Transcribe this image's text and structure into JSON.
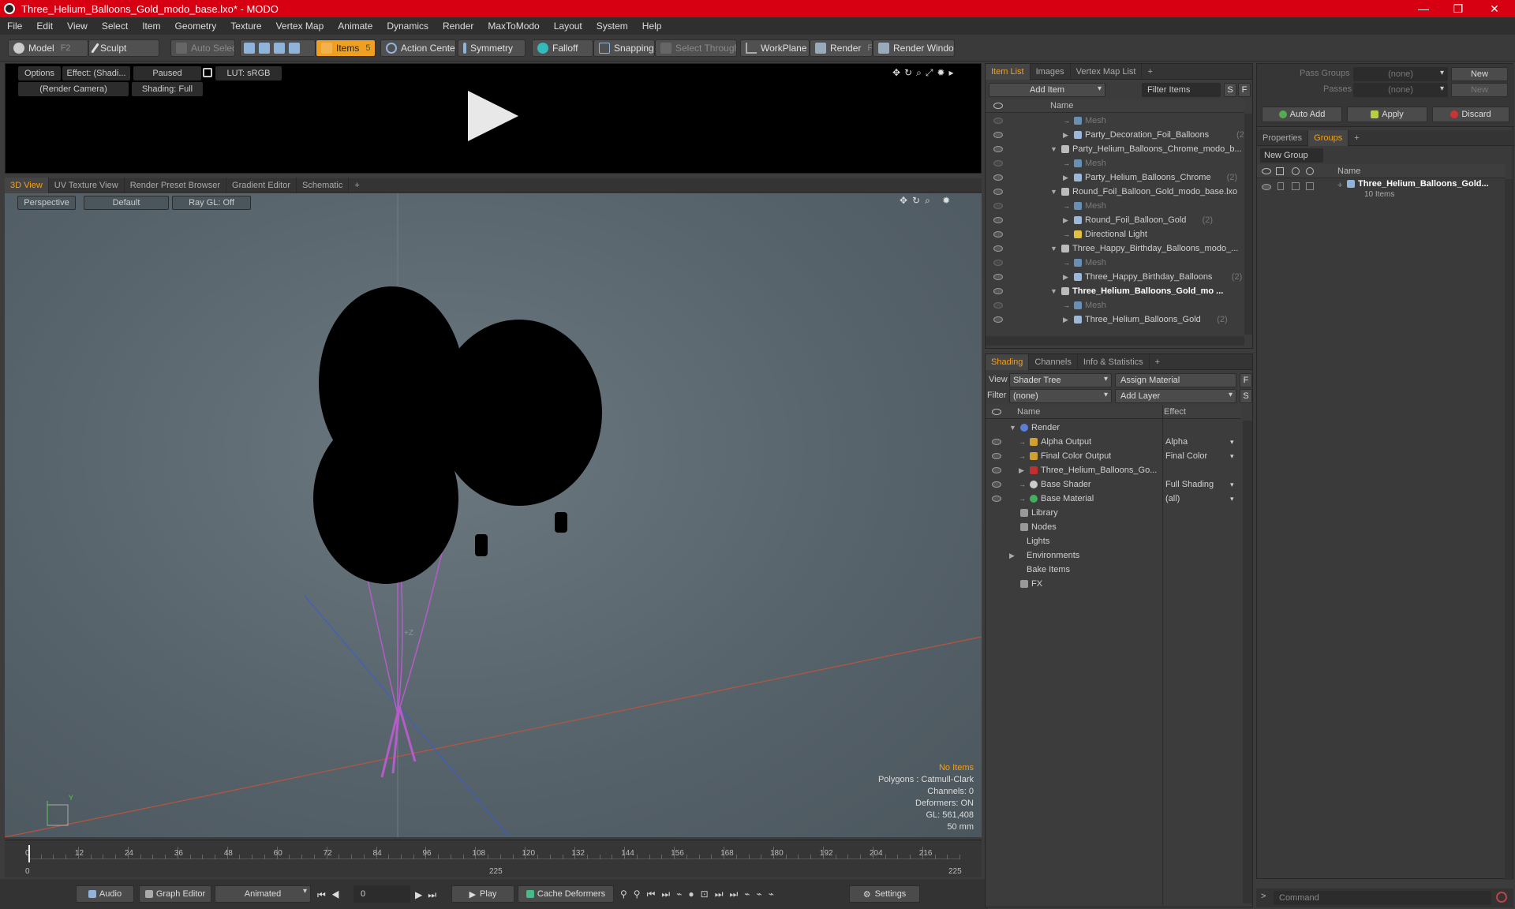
{
  "window": {
    "title": "Three_Helium_Balloons_Gold_modo_base.lxo* - MODO",
    "minimize": "—",
    "restore": "❐",
    "close": "✕"
  },
  "menu": [
    "File",
    "Edit",
    "View",
    "Select",
    "Item",
    "Geometry",
    "Texture",
    "Vertex Map",
    "Animate",
    "Dynamics",
    "Render",
    "MaxToModo",
    "Layout",
    "System",
    "Help"
  ],
  "toolbar": {
    "model": "Model",
    "model_key": "F2",
    "sculpt": "Sculpt",
    "auto_select": "Auto Select",
    "items": "Items",
    "items_key": "5",
    "action_center": "Action Center",
    "symmetry": "Symmetry",
    "falloff": "Falloff",
    "snapping": "Snapping",
    "select_through": "Select Through",
    "workplane": "WorkPlane",
    "render": "Render",
    "render_key": "F9",
    "render_window": "Render Window"
  },
  "preview": {
    "options": "Options",
    "effect": "Effect: (Shadi...",
    "paused": "Paused",
    "lut": "LUT: sRGB",
    "camera": "(Render Camera)",
    "shading": "Shading: Full"
  },
  "viewport_tabs": [
    "3D View",
    "UV Texture View",
    "Render Preset Browser",
    "Gradient Editor",
    "Schematic",
    "+"
  ],
  "viewport": {
    "perspective": "Perspective",
    "default": "Default",
    "raygl": "Ray GL: Off",
    "axis_z": "+Z",
    "axis_y": "Y",
    "info": {
      "no_items": "No Items",
      "polygons": "Polygons : Catmull-Clark",
      "channels": "Channels: 0",
      "deformers": "Deformers: ON",
      "gl": "GL: 561,408",
      "focal": "50 mm"
    }
  },
  "timeline": {
    "labels": [
      "0",
      "12",
      "24",
      "36",
      "48",
      "60",
      "72",
      "84",
      "96",
      "108",
      "120",
      "132",
      "144",
      "156",
      "168",
      "180",
      "192",
      "204",
      "216"
    ],
    "start": "0",
    "mid": "225",
    "end": "225"
  },
  "bottombar": {
    "audio": "Audio",
    "graph_editor": "Graph Editor",
    "animated": "Animated",
    "frame": "0",
    "play": "Play",
    "cache_deformers": "Cache Deformers",
    "settings": "Settings"
  },
  "itemlist": {
    "tabs": [
      "Item List",
      "Images",
      "Vertex Map List",
      "+"
    ],
    "add_item": "Add Item",
    "filter_items": "Filter Items",
    "s": "S",
    "f": "F",
    "col_name": "Name",
    "rows": [
      {
        "text": "Mesh",
        "count": "",
        "indent": 2,
        "type": "mesh",
        "arrow": "→",
        "dim": true,
        "bold": false
      },
      {
        "text": "Party_Decoration_Foil_Balloons",
        "count": "(2)",
        "indent": 2,
        "type": "group",
        "arrow": "▶",
        "dim": false,
        "bold": false
      },
      {
        "text": "Party_Helium_Balloons_Chrome_modo_b...",
        "count": "",
        "indent": 1,
        "type": "scene",
        "arrow": "▼",
        "dim": false,
        "bold": false
      },
      {
        "text": "Mesh",
        "count": "",
        "indent": 2,
        "type": "mesh",
        "arrow": "→",
        "dim": true,
        "bold": false
      },
      {
        "text": "Party_Helium_Balloons_Chrome",
        "count": "(2)",
        "indent": 2,
        "type": "group",
        "arrow": "▶",
        "dim": false,
        "bold": false
      },
      {
        "text": "Round_Foil_Balloon_Gold_modo_base.lxo",
        "count": "",
        "indent": 1,
        "type": "scene",
        "arrow": "▼",
        "dim": false,
        "bold": false
      },
      {
        "text": "Mesh",
        "count": "",
        "indent": 2,
        "type": "mesh",
        "arrow": "→",
        "dim": true,
        "bold": false
      },
      {
        "text": "Round_Foil_Balloon_Gold",
        "count": "(2)",
        "indent": 2,
        "type": "group",
        "arrow": "▶",
        "dim": false,
        "bold": false
      },
      {
        "text": "Directional Light",
        "count": "",
        "indent": 2,
        "type": "light",
        "arrow": "→",
        "dim": false,
        "bold": false
      },
      {
        "text": "Three_Happy_Birthday_Balloons_modo_...",
        "count": "",
        "indent": 1,
        "type": "scene",
        "arrow": "▼",
        "dim": false,
        "bold": false
      },
      {
        "text": "Mesh",
        "count": "",
        "indent": 2,
        "type": "mesh",
        "arrow": "→",
        "dim": true,
        "bold": false
      },
      {
        "text": "Three_Happy_Birthday_Balloons",
        "count": "(2)",
        "indent": 2,
        "type": "group",
        "arrow": "▶",
        "dim": false,
        "bold": false
      },
      {
        "text": "Three_Helium_Balloons_Gold_mo ...",
        "count": "",
        "indent": 1,
        "type": "scene",
        "arrow": "▼",
        "dim": false,
        "bold": true
      },
      {
        "text": "Mesh",
        "count": "",
        "indent": 2,
        "type": "mesh",
        "arrow": "→",
        "dim": true,
        "bold": false
      },
      {
        "text": "Three_Helium_Balloons_Gold",
        "count": "(2)",
        "indent": 2,
        "type": "group",
        "arrow": "▶",
        "dim": false,
        "bold": false
      }
    ]
  },
  "shading": {
    "tabs": [
      "Shading",
      "Channels",
      "Info & Statistics",
      "+"
    ],
    "view_label": "View",
    "view_value": "Shader Tree",
    "assign_material": "Assign Material",
    "f": "F",
    "filter_label": "Filter",
    "filter_value": "(none)",
    "add_layer": "Add Layer",
    "s": "S",
    "col_name": "Name",
    "col_effect": "Effect",
    "rows": [
      {
        "text": "Render",
        "effect": "",
        "indent": 1,
        "arrow": "▼",
        "eye": false,
        "color": "#5a7fd8"
      },
      {
        "text": "Alpha Output",
        "effect": "Alpha",
        "indent": 2,
        "arrow": "→",
        "eye": true,
        "color": "#d0a030"
      },
      {
        "text": "Final Color Output",
        "effect": "Final Color",
        "indent": 2,
        "arrow": "→",
        "eye": true,
        "color": "#d0a030"
      },
      {
        "text": "Three_Helium_Balloons_Go...",
        "effect": "",
        "indent": 2,
        "arrow": "▶",
        "eye": true,
        "color": "#c03030"
      },
      {
        "text": "Base Shader",
        "effect": "Full Shading",
        "indent": 2,
        "arrow": "→",
        "eye": true,
        "color": "#cccccc"
      },
      {
        "text": "Base Material",
        "effect": "(all)",
        "indent": 2,
        "arrow": "→",
        "eye": true,
        "color": "#40b060"
      },
      {
        "text": "Library",
        "effect": "",
        "indent": 1,
        "arrow": "",
        "eye": false,
        "color": "#999999"
      },
      {
        "text": "Nodes",
        "effect": "",
        "indent": 1,
        "arrow": "",
        "eye": false,
        "color": "#999999"
      },
      {
        "text": "Lights",
        "effect": "",
        "indent": 0,
        "arrow": "",
        "eye": false,
        "color": ""
      },
      {
        "text": "Environments",
        "effect": "",
        "indent": 0,
        "arrow": "▶",
        "eye": false,
        "color": ""
      },
      {
        "text": "Bake Items",
        "effect": "",
        "indent": 0,
        "arrow": "",
        "eye": false,
        "color": ""
      },
      {
        "text": "FX",
        "effect": "",
        "indent": 1,
        "arrow": "",
        "eye": false,
        "color": "#999999"
      }
    ]
  },
  "passes": {
    "pass_groups": "Pass Groups",
    "pass_groups_value": "(none)",
    "new": "New",
    "passes": "Passes",
    "passes_value": "(none)",
    "new2": "New",
    "auto_add": "Auto Add",
    "apply": "Apply",
    "discard": "Discard"
  },
  "groups": {
    "tabs": [
      "Properties",
      "Groups",
      "+"
    ],
    "new_group": "New Group",
    "col_name": "Name",
    "item_name": "Three_Helium_Balloons_Gold...",
    "item_sub": "10 Items"
  },
  "command": {
    "placeholder": "Command"
  },
  "colors": {
    "accent": "#f0a020",
    "title_red": "#d70012",
    "balloon_string": "#b45cc8"
  }
}
